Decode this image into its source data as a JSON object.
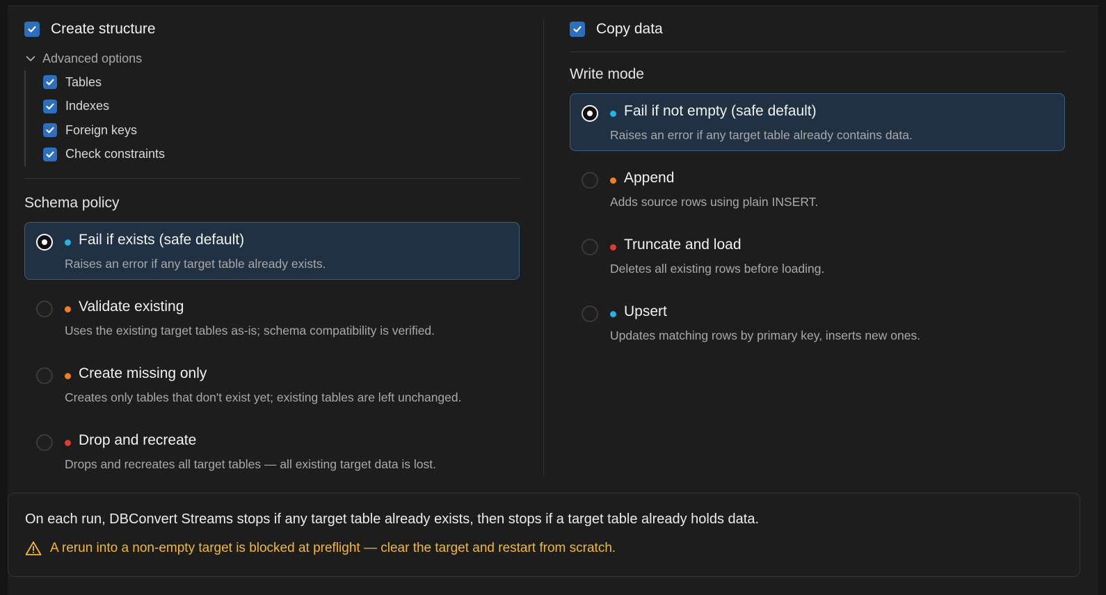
{
  "colors": {
    "accent_blue": "#2d6fbf",
    "dot_safe": "#1fb6e6",
    "dot_warn": "#f57c1f",
    "dot_danger": "#e53935",
    "warning_text": "#f5b82e"
  },
  "create_structure": {
    "label": "Create structure",
    "checked": true,
    "advanced_label": "Advanced options",
    "items": [
      {
        "label": "Tables",
        "checked": true
      },
      {
        "label": "Indexes",
        "checked": true
      },
      {
        "label": "Foreign keys",
        "checked": true
      },
      {
        "label": "Check constraints",
        "checked": true
      }
    ]
  },
  "schema_policy": {
    "heading": "Schema policy",
    "options": [
      {
        "title": "Fail if exists (safe default)",
        "desc": "Raises an error if any target table already exists.",
        "dot": "safe",
        "selected": true
      },
      {
        "title": "Validate existing",
        "desc": "Uses the existing target tables as-is; schema compatibility is verified.",
        "dot": "warn",
        "selected": false
      },
      {
        "title": "Create missing only",
        "desc": "Creates only tables that don't exist yet; existing tables are left unchanged.",
        "dot": "warn",
        "selected": false
      },
      {
        "title": "Drop and recreate",
        "desc": "Drops and recreates all target tables — all existing target data is lost.",
        "dot": "danger",
        "selected": false
      }
    ]
  },
  "copy_data": {
    "label": "Copy data",
    "checked": true
  },
  "write_mode": {
    "heading": "Write mode",
    "options": [
      {
        "title": "Fail if not empty (safe default)",
        "desc": "Raises an error if any target table already contains data.",
        "dot": "safe",
        "selected": true
      },
      {
        "title": "Append",
        "desc": "Adds source rows using plain INSERT.",
        "dot": "warn",
        "selected": false
      },
      {
        "title": "Truncate and load",
        "desc": "Deletes all existing rows before loading.",
        "dot": "danger",
        "selected": false
      },
      {
        "title": "Upsert",
        "desc": "Updates matching rows by primary key, inserts new ones.",
        "dot": "safe",
        "selected": false
      }
    ]
  },
  "summary": {
    "text": "On each run, DBConvert Streams stops if any target table already exists, then stops if a target table already holds data.",
    "warning": "A rerun into a non-empty target is blocked at preflight — clear the target and restart from scratch.",
    "warning_icon": "warning-triangle-icon"
  }
}
